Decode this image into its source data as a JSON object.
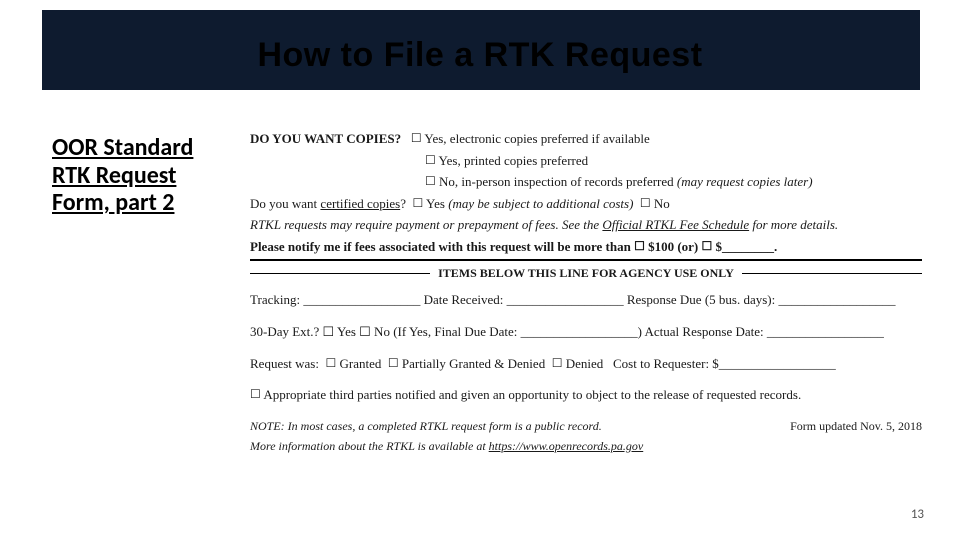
{
  "title": "How to File a RTK Request",
  "subtitle": "OOR Standard RTK Request Form, part 2",
  "page_number": "13",
  "form": {
    "copies_question": "DO YOU WANT COPIES?",
    "opt_electronic": "Yes, electronic copies preferred if available",
    "opt_printed": "Yes, printed copies preferred",
    "opt_inperson": "No, in-person inspection of records preferred",
    "opt_inperson_note": "(may request copies later)",
    "certified_question": "Do you want",
    "certified_link": "certified copies",
    "certified_q_end": "?",
    "certified_yes": "Yes",
    "certified_yes_note": "(may be subject to additional costs)",
    "certified_no": "No",
    "prepay_note_pre": "RTKL requests may require payment or prepayment of fees. See the",
    "fee_schedule_link": "Official RTKL Fee Schedule",
    "prepay_note_post": "for more details.",
    "notify_line_pre": "Please notify me if fees associated with this request will be more than",
    "notify_100": "$100 (or)",
    "notify_dollar": "$________.",
    "agency_only": "ITEMS BELOW THIS LINE FOR AGENCY USE ONLY",
    "tracking": "Tracking: __________________  Date Received: __________________  Response Due (5 bus. days): __________________",
    "ext_line": "30-Day Ext.?  ☐ Yes  ☐ No  (If Yes, Final Due Date: __________________)  Actual Response Date: __________________",
    "request_was_pre": "Request was:",
    "granted": "Granted",
    "partial": "Partially Granted & Denied",
    "denied": "Denied",
    "cost": "Cost to Requester: $__________________",
    "third_party": "Appropriate third parties notified and given an opportunity to object to the release of requested records.",
    "note_pre": "NOTE: In most cases, a completed RTKL request form is a public record.",
    "form_updated": "Form updated Nov. 5, 2018",
    "more_info_pre": "More information about the RTKL is available at",
    "more_info_url": "https://www.openrecords.pa.gov"
  }
}
